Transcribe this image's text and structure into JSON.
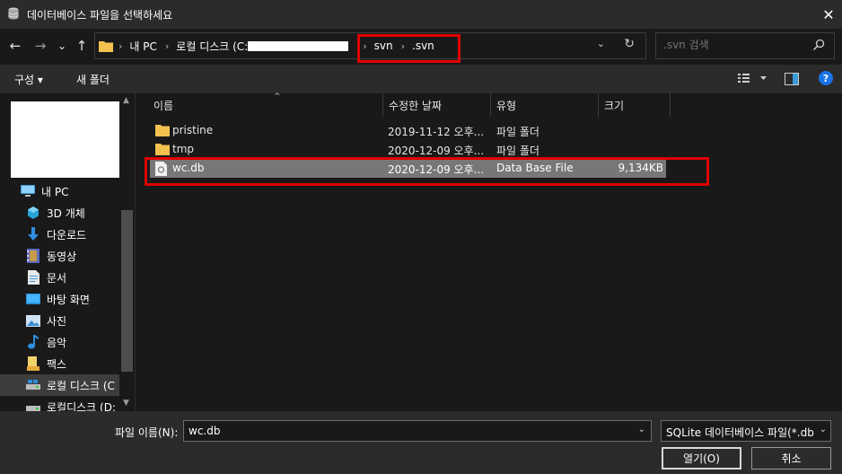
{
  "window": {
    "title": "데이터베이스 파일을 선택하세요",
    "app_icon": "database-icon",
    "close_glyph": "✕"
  },
  "nav": {
    "back_glyph": "←",
    "forward_glyph": "→",
    "recent_glyph": "⌄",
    "up_glyph": "↑"
  },
  "address": {
    "crumbs": [
      "내 PC",
      "로컬 디스크 (C:",
      "svn",
      ".svn"
    ],
    "separator": "›",
    "dropdown_glyph": "⌄",
    "refresh_glyph": "↻"
  },
  "search": {
    "placeholder": ".svn 검색"
  },
  "toolbar": {
    "organize_label": "구성 ▾",
    "new_folder_label": "새 폴더",
    "help_glyph": "?"
  },
  "sidebar": {
    "items": [
      {
        "label": "내 PC",
        "icon": "computer-icon"
      },
      {
        "label": "3D 개체",
        "icon": "cube-icon"
      },
      {
        "label": "다운로드",
        "icon": "download-icon"
      },
      {
        "label": "동영상",
        "icon": "video-icon"
      },
      {
        "label": "문서",
        "icon": "document-icon"
      },
      {
        "label": "바탕 화면",
        "icon": "desktop-icon"
      },
      {
        "label": "사진",
        "icon": "picture-icon"
      },
      {
        "label": "음악",
        "icon": "music-icon"
      },
      {
        "label": "팩스",
        "icon": "fax-icon"
      },
      {
        "label": "로컬 디스크 (C",
        "icon": "drive-icon"
      },
      {
        "label": "로컬디스크 (D:",
        "icon": "drive-icon"
      }
    ]
  },
  "columns": {
    "name": "이름",
    "modified": "수정한 날짜",
    "type": "유형",
    "size": "크기"
  },
  "files": [
    {
      "name": "pristine",
      "modified": "2019-11-12 오후...",
      "type": "파일 폴더",
      "size": "",
      "icon": "folder-icon"
    },
    {
      "name": "tmp",
      "modified": "2020-12-09 오후...",
      "type": "파일 폴더",
      "size": "",
      "icon": "folder-icon"
    },
    {
      "name": "wc.db",
      "modified": "2020-12-09 오후...",
      "type": "Data Base File",
      "size": "9,134KB",
      "icon": "file-icon"
    }
  ],
  "footer": {
    "filename_label": "파일 이름(N):",
    "filename_value": "wc.db",
    "filetype_value": "SQLite 데이터베이스 파일(*.db",
    "open_label": "열기(O)",
    "cancel_label": "취소"
  },
  "colors": {
    "highlight": "#e00000",
    "folder": "#f2c14e",
    "help": "#1a73e8"
  }
}
